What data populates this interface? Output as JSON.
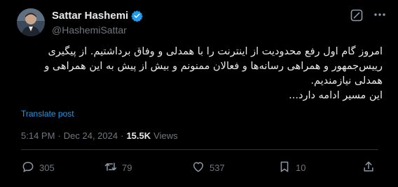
{
  "author": {
    "name": "Sattar Hashemi",
    "handle": "@HashemiSattar"
  },
  "post": {
    "lines": [
      "امروز گام اول رفع محدودیت از اینترنت را با همدلی و وفاق برداشتیم. از پیگیری",
      "رییس‌جمهور و همراهی رسانه‌ها و فعالان ممنونم و بیش از پیش به این همراهی و",
      "همدلی نیازمندیم.",
      "این مسیر ادامه دارد..."
    ],
    "translate_label": "Translate post"
  },
  "meta": {
    "time": "5:14 PM",
    "separator1": "·",
    "date": "Dec 24, 2024",
    "separator2": "·",
    "views_count": "15.5K",
    "views_label": "Views"
  },
  "actions": {
    "replies": "305",
    "reposts": "79",
    "likes": "537",
    "bookmarks": "10"
  },
  "colors": {
    "background": "#000000",
    "text": "#e7e9ea",
    "muted": "#71767b",
    "accent": "#1d9bf0"
  },
  "icons": [
    "verified-badge-icon",
    "grok-icon",
    "more-icon",
    "reply-icon",
    "repost-icon",
    "like-icon",
    "bookmark-icon",
    "share-icon"
  ]
}
